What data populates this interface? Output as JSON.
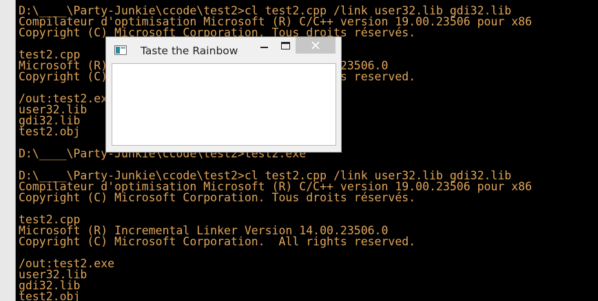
{
  "console": {
    "lines": [
      "D:\\____\\Party-Junkie\\ccode\\test2>cl test2.cpp /link user32.lib gdi32.lib",
      "Compilateur d'optimisation Microsoft (R) C/C++ version 19.00.23506 pour x86",
      "Copyright (C) Microsoft Corporation. Tous droits réservés.",
      "",
      "test2.cpp",
      "Microsoft (R) Incremental Linker Version 14.00.23506.0",
      "Copyright (C) Microsoft Corporation.  All rights reserved.",
      "",
      "/out:test2.exe",
      "user32.lib",
      "gdi32.lib",
      "test2.obj",
      "",
      "D:\\____\\Party-Junkie\\ccode\\test2>test2.exe",
      "",
      "D:\\____\\Party-Junkie\\ccode\\test2>cl test2.cpp /link user32.lib gdi32.lib",
      "Compilateur d'optimisation Microsoft (R) C/C++ version 19.00.23506 pour x86",
      "Copyright (C) Microsoft Corporation. Tous droits réservés.",
      "",
      "test2.cpp",
      "Microsoft (R) Incremental Linker Version 14.00.23506.0",
      "Copyright (C) Microsoft Corporation.  All rights reserved.",
      "",
      "/out:test2.exe",
      "user32.lib",
      "gdi32.lib",
      "test2.obj"
    ],
    "text_color": "#e2a65a",
    "background": "#000000"
  },
  "window": {
    "title": "Taste the Rainbow",
    "icon": "application-icon",
    "controls": {
      "minimize_icon": "minimize-icon",
      "maximize_icon": "maximize-icon",
      "close_icon": "close-icon"
    },
    "close_button_color": "#c7c7c7"
  }
}
